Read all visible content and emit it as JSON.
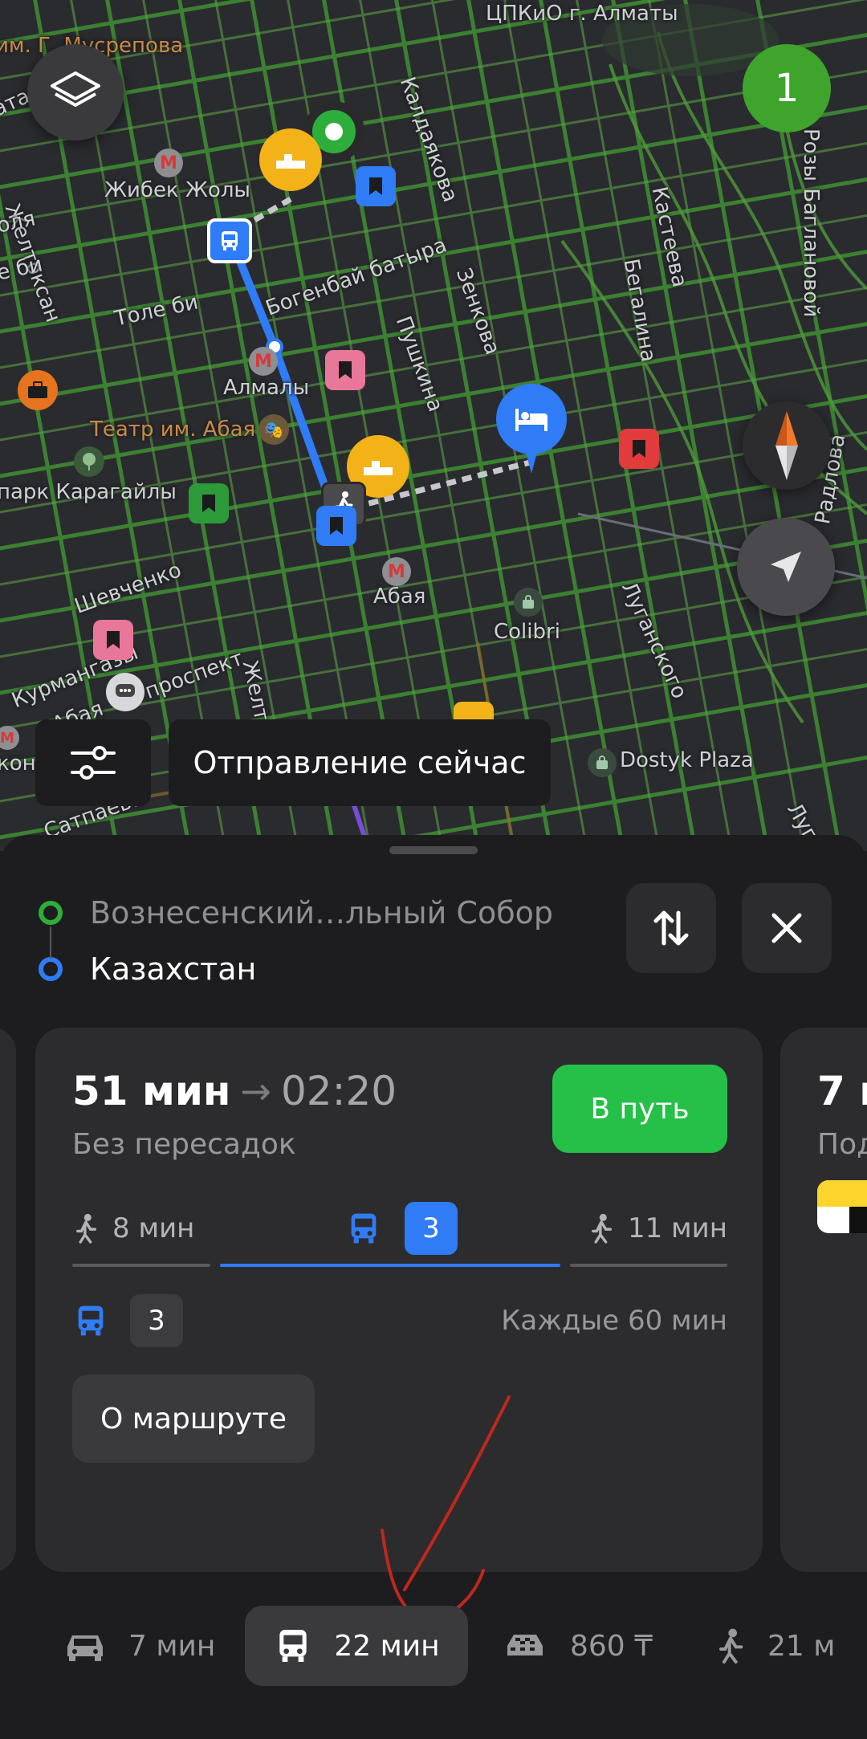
{
  "map": {
    "labels": {
      "street_musrepova": "им. Г. Мусрепова",
      "park_almaty": "ЦПКиО г. Алматы",
      "metro_zhibek": "Жибек Жолы",
      "street_zheltoksan": "Желтоксан",
      "street_tole_bi_left": "Толе би",
      "street_tole_bi": "Толе би",
      "street_bogenbay": "Богенбай батыра",
      "street_kaldayakova": "Калдаякова",
      "street_zenkova": "Зенкова",
      "street_pushkina": "Пушкина",
      "street_kasteeva": "Кастеева",
      "street_begalina": "Бегалина",
      "street_baganova": "Розы Баглановой",
      "metro_almaly": "Алмалы",
      "theatre_abay": "Театр им. Абая",
      "park_karagaily": "парк Карагайлы",
      "street_shevchenko": "Шевченко",
      "metro_abaya": "Абая",
      "shop_colibri": "Colibri",
      "street_luganskogo": "Луганского",
      "street_radlova": "Радлова",
      "street_kurmangazy": "Курмангазы",
      "street_abaya": "Абая",
      "street_prospekt": "проспект",
      "street_satpaeva": "Сатпаева",
      "street_zheltoksan2": "Желтоксан",
      "shop_dostyk": "Dostyk Plaza",
      "left_edge": "атае",
      "left_edge2": "оля",
      "left_edge3": "е би",
      "left_edge4": "кону",
      "street_lug_right": "Луг"
    },
    "counter": "1",
    "departure": "Отправление сейчас"
  },
  "route": {
    "from": "Вознесенский…льный Собор",
    "to": "Казахстан"
  },
  "card": {
    "duration": "51 мин",
    "arrival": "02:20",
    "subtitle": "Без пересадок",
    "go_label": "В путь",
    "walk_start": "8 мин",
    "bus_number": "3",
    "walk_end": "11 мин",
    "bus_number_2": "3",
    "frequency": "Каждые 60 мин",
    "about_label": "О маршруте"
  },
  "card_peek": {
    "time": "7 м",
    "subtitle": "Под"
  },
  "tabs": {
    "car": "7 мин",
    "transit": "22 мин",
    "taxi": "860 ₸",
    "walk": "21 м"
  },
  "colors": {
    "accent_blue": "#2f7cf6",
    "go_green": "#24c047",
    "traffic_green": "#4f9a3a",
    "start_green": "#3ea42c"
  },
  "icons": {
    "layers": "layers-icon",
    "compass": "compass-icon",
    "locate": "location-arrow-icon",
    "settings": "sliders-icon",
    "swap": "swap-arrows-icon",
    "close": "close-icon",
    "bus": "bus-icon",
    "walk": "walk-icon",
    "car": "car-icon",
    "taxi": "taxi-icon"
  }
}
